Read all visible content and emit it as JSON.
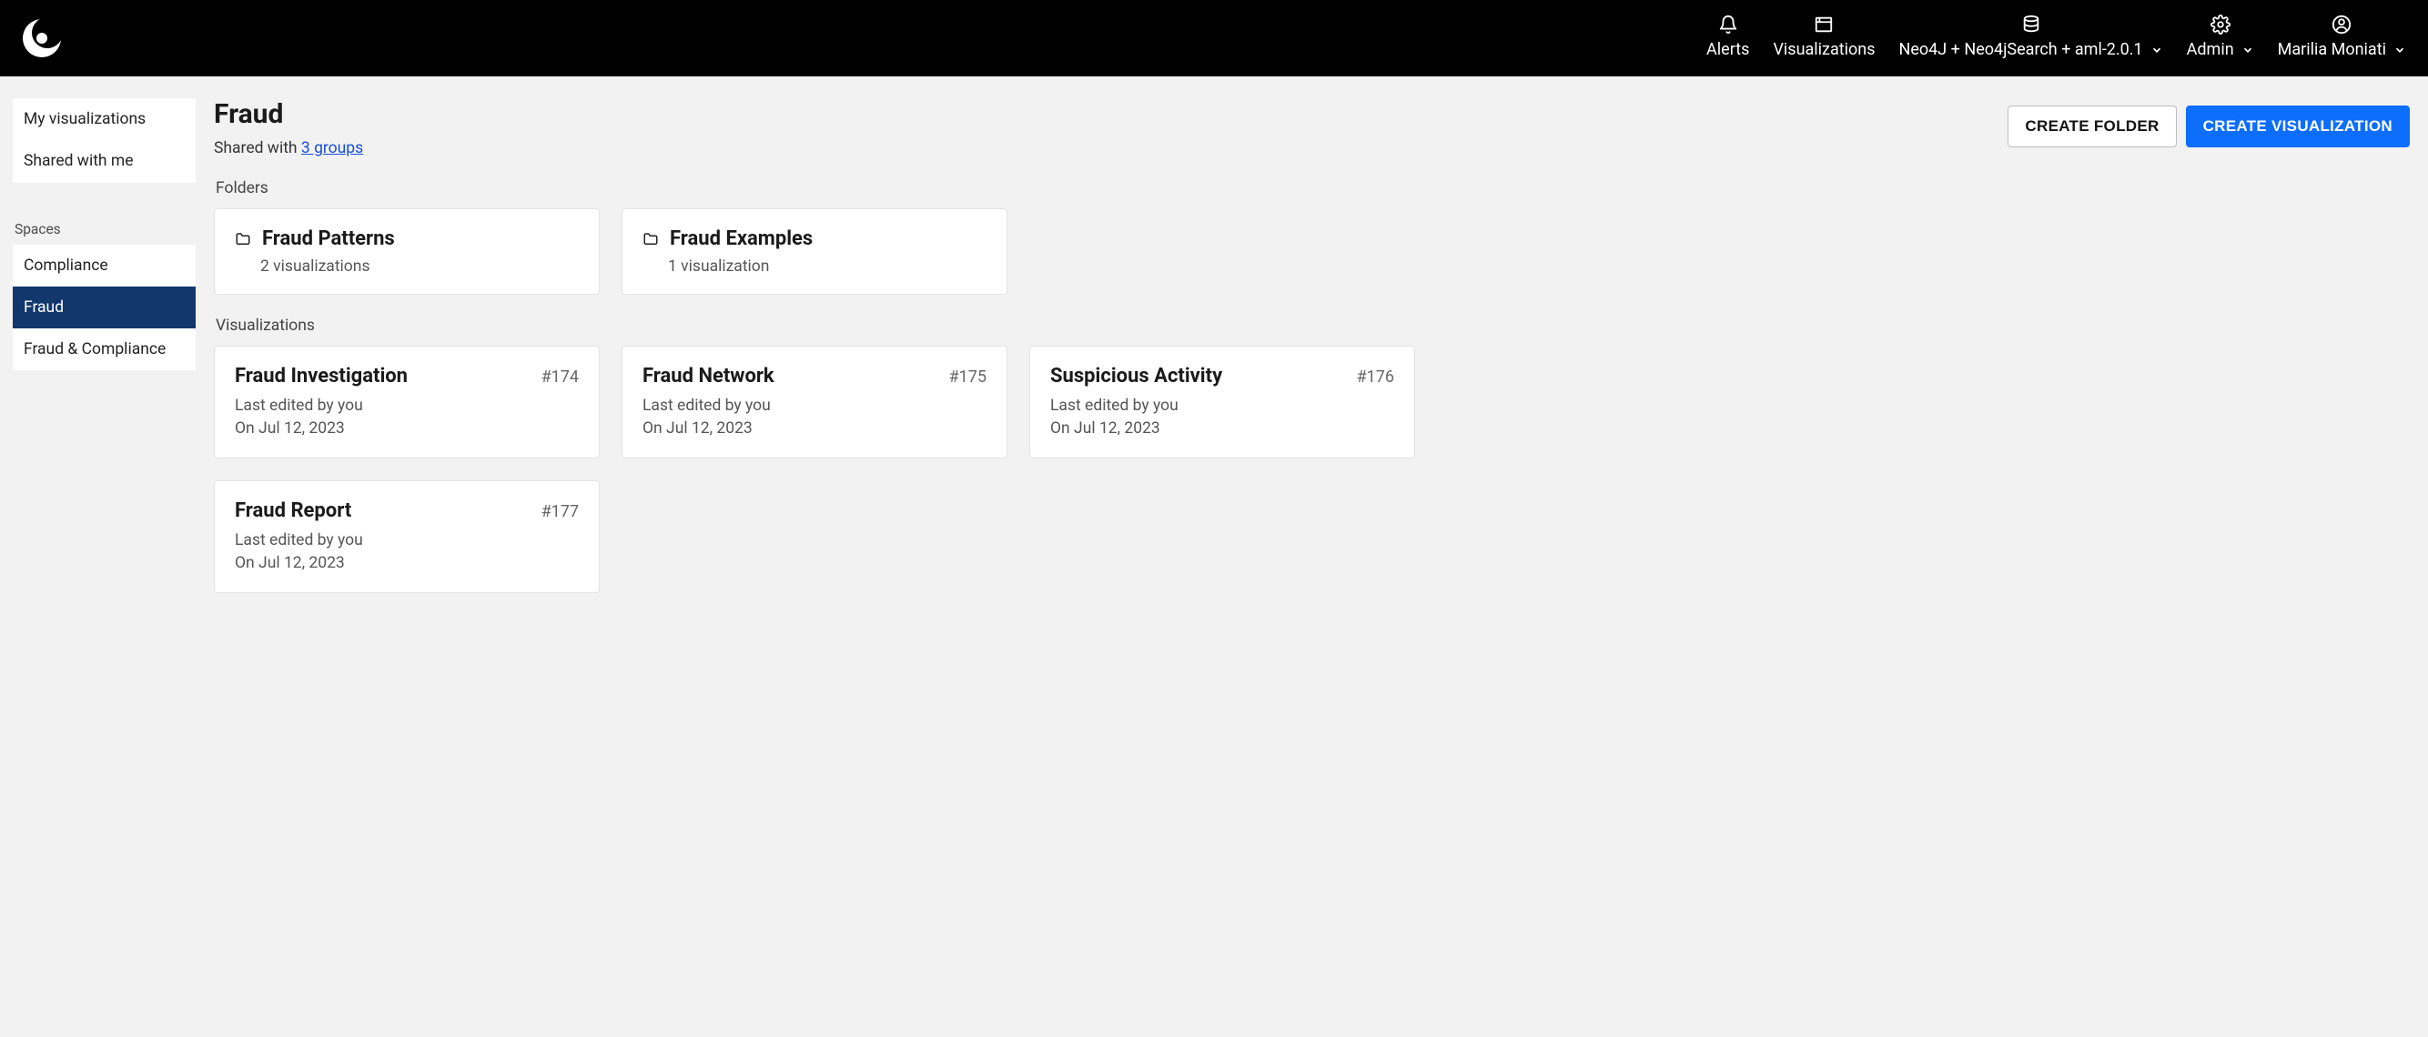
{
  "topbar": {
    "alerts_label": "Alerts",
    "visualizations_label": "Visualizations",
    "datasource_label": "Neo4J + Neo4jSearch + aml-2.0.1",
    "admin_label": "Admin",
    "user_label": "Marilia Moniati"
  },
  "sidebar": {
    "my_visualizations": "My visualizations",
    "shared_with_me": "Shared with me",
    "spaces_heading": "Spaces",
    "spaces": [
      {
        "label": "Compliance"
      },
      {
        "label": "Fraud"
      },
      {
        "label": "Fraud & Compliance"
      }
    ]
  },
  "header": {
    "title": "Fraud",
    "shared_prefix": "Shared with ",
    "shared_link": "3 groups",
    "create_folder": "Create Folder",
    "create_visualization": "Create Visualization"
  },
  "sections": {
    "folders_heading": "Folders",
    "visualizations_heading": "Visualizations"
  },
  "folders": [
    {
      "title": "Fraud Patterns",
      "subtitle": "2 visualizations"
    },
    {
      "title": "Fraud Examples",
      "subtitle": "1 visualization"
    }
  ],
  "visualizations": [
    {
      "title": "Fraud Investigation",
      "id": "#174",
      "editor": "Last edited by you",
      "date": "On Jul 12, 2023"
    },
    {
      "title": "Fraud Network",
      "id": "#175",
      "editor": "Last edited by you",
      "date": "On Jul 12, 2023"
    },
    {
      "title": "Suspicious Activity",
      "id": "#176",
      "editor": "Last edited by you",
      "date": "On Jul 12, 2023"
    },
    {
      "title": "Fraud Report",
      "id": "#177",
      "editor": "Last edited by you",
      "date": "On Jul 12, 2023"
    }
  ]
}
